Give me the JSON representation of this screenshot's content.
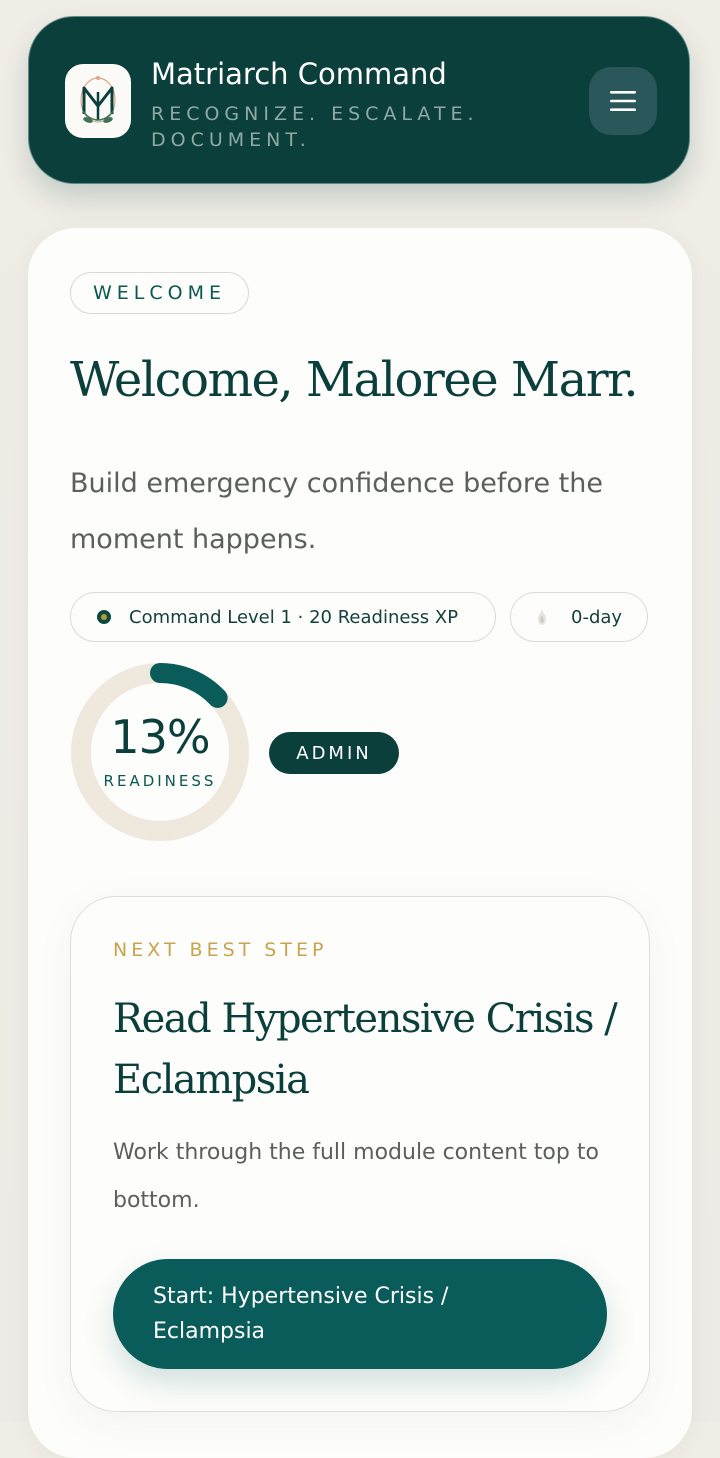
{
  "header": {
    "brand_title": "Matriarch Command",
    "tagline": "RECOGNIZE. ESCALATE. DOCUMENT.",
    "logo_monogram": "M",
    "menu_icon": "hamburger-menu-icon"
  },
  "welcome": {
    "eyebrow": "WELCOME",
    "heading": "Welcome, Maloree Marr.",
    "subtitle": "Build emergency confidence before the moment happens.",
    "level_chip": "Command Level 1 · 20 Readiness XP",
    "streak_chip": "0-day",
    "readiness": {
      "value_text": "13%",
      "label": "READINESS",
      "fraction": 0.13
    },
    "role_badge": "ADMIN"
  },
  "next_step": {
    "eyebrow": "NEXT BEST STEP",
    "title": "Read Hypertensive Crisis / Eclampsia",
    "description": "Work through the full module content top to bottom.",
    "button_label": "Start: Hypertensive Crisis / Eclampsia"
  },
  "colors": {
    "brand_dark": "#0b3f3b",
    "accent_teal": "#0a5c5a",
    "accent_gold": "#c9a44e",
    "ring_track": "#efe8dc"
  }
}
